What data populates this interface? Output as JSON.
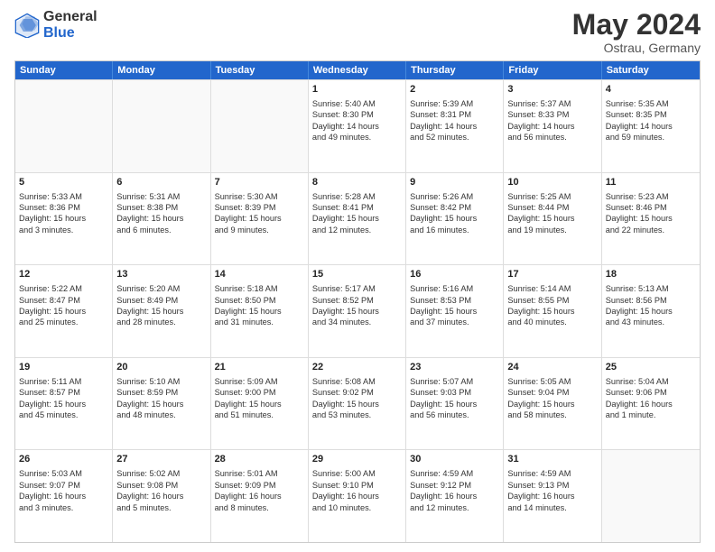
{
  "logo": {
    "general": "General",
    "blue": "Blue"
  },
  "title": "May 2024",
  "subtitle": "Ostrau, Germany",
  "headers": [
    "Sunday",
    "Monday",
    "Tuesday",
    "Wednesday",
    "Thursday",
    "Friday",
    "Saturday"
  ],
  "rows": [
    [
      {
        "day": "",
        "lines": []
      },
      {
        "day": "",
        "lines": []
      },
      {
        "day": "",
        "lines": []
      },
      {
        "day": "1",
        "lines": [
          "Sunrise: 5:40 AM",
          "Sunset: 8:30 PM",
          "Daylight: 14 hours",
          "and 49 minutes."
        ]
      },
      {
        "day": "2",
        "lines": [
          "Sunrise: 5:39 AM",
          "Sunset: 8:31 PM",
          "Daylight: 14 hours",
          "and 52 minutes."
        ]
      },
      {
        "day": "3",
        "lines": [
          "Sunrise: 5:37 AM",
          "Sunset: 8:33 PM",
          "Daylight: 14 hours",
          "and 56 minutes."
        ]
      },
      {
        "day": "4",
        "lines": [
          "Sunrise: 5:35 AM",
          "Sunset: 8:35 PM",
          "Daylight: 14 hours",
          "and 59 minutes."
        ]
      }
    ],
    [
      {
        "day": "5",
        "lines": [
          "Sunrise: 5:33 AM",
          "Sunset: 8:36 PM",
          "Daylight: 15 hours",
          "and 3 minutes."
        ]
      },
      {
        "day": "6",
        "lines": [
          "Sunrise: 5:31 AM",
          "Sunset: 8:38 PM",
          "Daylight: 15 hours",
          "and 6 minutes."
        ]
      },
      {
        "day": "7",
        "lines": [
          "Sunrise: 5:30 AM",
          "Sunset: 8:39 PM",
          "Daylight: 15 hours",
          "and 9 minutes."
        ]
      },
      {
        "day": "8",
        "lines": [
          "Sunrise: 5:28 AM",
          "Sunset: 8:41 PM",
          "Daylight: 15 hours",
          "and 12 minutes."
        ]
      },
      {
        "day": "9",
        "lines": [
          "Sunrise: 5:26 AM",
          "Sunset: 8:42 PM",
          "Daylight: 15 hours",
          "and 16 minutes."
        ]
      },
      {
        "day": "10",
        "lines": [
          "Sunrise: 5:25 AM",
          "Sunset: 8:44 PM",
          "Daylight: 15 hours",
          "and 19 minutes."
        ]
      },
      {
        "day": "11",
        "lines": [
          "Sunrise: 5:23 AM",
          "Sunset: 8:46 PM",
          "Daylight: 15 hours",
          "and 22 minutes."
        ]
      }
    ],
    [
      {
        "day": "12",
        "lines": [
          "Sunrise: 5:22 AM",
          "Sunset: 8:47 PM",
          "Daylight: 15 hours",
          "and 25 minutes."
        ]
      },
      {
        "day": "13",
        "lines": [
          "Sunrise: 5:20 AM",
          "Sunset: 8:49 PM",
          "Daylight: 15 hours",
          "and 28 minutes."
        ]
      },
      {
        "day": "14",
        "lines": [
          "Sunrise: 5:18 AM",
          "Sunset: 8:50 PM",
          "Daylight: 15 hours",
          "and 31 minutes."
        ]
      },
      {
        "day": "15",
        "lines": [
          "Sunrise: 5:17 AM",
          "Sunset: 8:52 PM",
          "Daylight: 15 hours",
          "and 34 minutes."
        ]
      },
      {
        "day": "16",
        "lines": [
          "Sunrise: 5:16 AM",
          "Sunset: 8:53 PM",
          "Daylight: 15 hours",
          "and 37 minutes."
        ]
      },
      {
        "day": "17",
        "lines": [
          "Sunrise: 5:14 AM",
          "Sunset: 8:55 PM",
          "Daylight: 15 hours",
          "and 40 minutes."
        ]
      },
      {
        "day": "18",
        "lines": [
          "Sunrise: 5:13 AM",
          "Sunset: 8:56 PM",
          "Daylight: 15 hours",
          "and 43 minutes."
        ]
      }
    ],
    [
      {
        "day": "19",
        "lines": [
          "Sunrise: 5:11 AM",
          "Sunset: 8:57 PM",
          "Daylight: 15 hours",
          "and 45 minutes."
        ]
      },
      {
        "day": "20",
        "lines": [
          "Sunrise: 5:10 AM",
          "Sunset: 8:59 PM",
          "Daylight: 15 hours",
          "and 48 minutes."
        ]
      },
      {
        "day": "21",
        "lines": [
          "Sunrise: 5:09 AM",
          "Sunset: 9:00 PM",
          "Daylight: 15 hours",
          "and 51 minutes."
        ]
      },
      {
        "day": "22",
        "lines": [
          "Sunrise: 5:08 AM",
          "Sunset: 9:02 PM",
          "Daylight: 15 hours",
          "and 53 minutes."
        ]
      },
      {
        "day": "23",
        "lines": [
          "Sunrise: 5:07 AM",
          "Sunset: 9:03 PM",
          "Daylight: 15 hours",
          "and 56 minutes."
        ]
      },
      {
        "day": "24",
        "lines": [
          "Sunrise: 5:05 AM",
          "Sunset: 9:04 PM",
          "Daylight: 15 hours",
          "and 58 minutes."
        ]
      },
      {
        "day": "25",
        "lines": [
          "Sunrise: 5:04 AM",
          "Sunset: 9:06 PM",
          "Daylight: 16 hours",
          "and 1 minute."
        ]
      }
    ],
    [
      {
        "day": "26",
        "lines": [
          "Sunrise: 5:03 AM",
          "Sunset: 9:07 PM",
          "Daylight: 16 hours",
          "and 3 minutes."
        ]
      },
      {
        "day": "27",
        "lines": [
          "Sunrise: 5:02 AM",
          "Sunset: 9:08 PM",
          "Daylight: 16 hours",
          "and 5 minutes."
        ]
      },
      {
        "day": "28",
        "lines": [
          "Sunrise: 5:01 AM",
          "Sunset: 9:09 PM",
          "Daylight: 16 hours",
          "and 8 minutes."
        ]
      },
      {
        "day": "29",
        "lines": [
          "Sunrise: 5:00 AM",
          "Sunset: 9:10 PM",
          "Daylight: 16 hours",
          "and 10 minutes."
        ]
      },
      {
        "day": "30",
        "lines": [
          "Sunrise: 4:59 AM",
          "Sunset: 9:12 PM",
          "Daylight: 16 hours",
          "and 12 minutes."
        ]
      },
      {
        "day": "31",
        "lines": [
          "Sunrise: 4:59 AM",
          "Sunset: 9:13 PM",
          "Daylight: 16 hours",
          "and 14 minutes."
        ]
      },
      {
        "day": "",
        "lines": []
      }
    ]
  ]
}
